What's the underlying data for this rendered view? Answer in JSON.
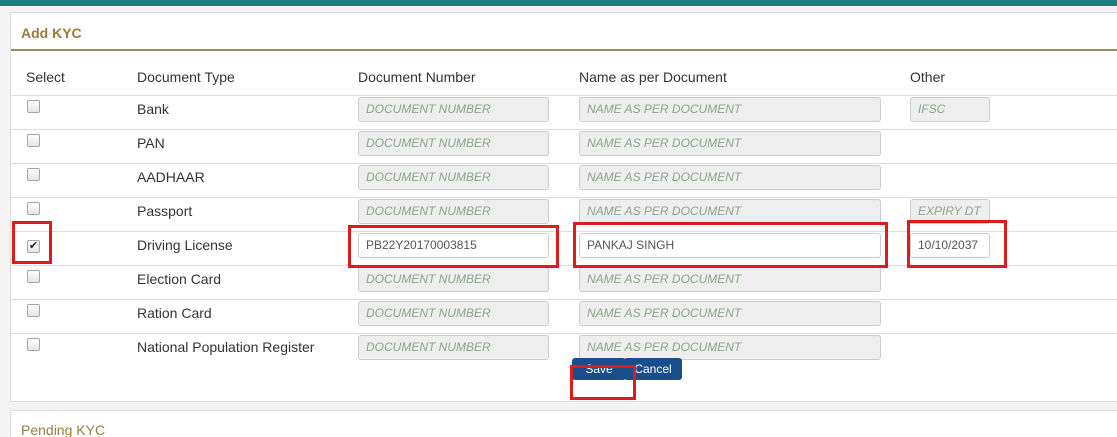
{
  "panel_title": "Add KYC",
  "columns": {
    "select": "Select",
    "doc_type": "Document Type",
    "doc_number": "Document Number",
    "name": "Name as per Document",
    "other": "Other"
  },
  "placeholders": {
    "doc_number": "DOCUMENT NUMBER",
    "name": "NAME AS PER DOCUMENT",
    "ifsc": "IFSC",
    "expiry": "EXPIRY DT"
  },
  "rows": [
    {
      "type": "Bank",
      "checked": false
    },
    {
      "type": "PAN",
      "checked": false
    },
    {
      "type": "AADHAAR",
      "checked": false
    },
    {
      "type": "Passport",
      "checked": false
    },
    {
      "type": "Driving License",
      "checked": true,
      "doc_number": "PB22Y20170003815",
      "name": "PANKAJ SINGH",
      "other": "10/10/2037"
    },
    {
      "type": "Election Card",
      "checked": false
    },
    {
      "type": "Ration Card",
      "checked": false
    },
    {
      "type": "National Population Register",
      "checked": false
    }
  ],
  "checkbox_checked_glyph": "✔",
  "buttons": {
    "save": "Save",
    "cancel": "Cancel"
  },
  "pending_title": "Pending KYC",
  "colors": {
    "accent_bar": "#1a7f7a",
    "title_brown": "#9b7a3f",
    "button_blue": "#1a4d8c",
    "highlight_red": "#e01b1b"
  }
}
